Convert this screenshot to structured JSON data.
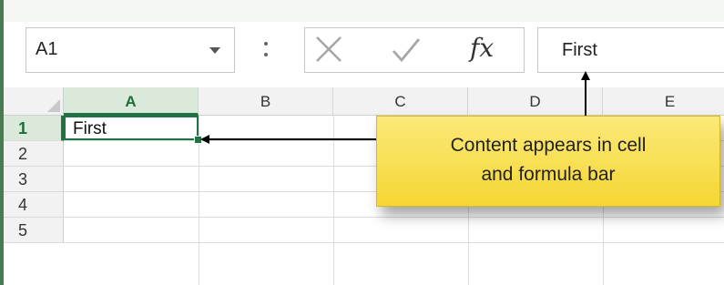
{
  "name_box": {
    "value": "A1"
  },
  "formula_bar": {
    "value": "First"
  },
  "columns": [
    "A",
    "B",
    "C",
    "D",
    "E"
  ],
  "rows": [
    "1",
    "2",
    "3",
    "4",
    "5"
  ],
  "cells": {
    "A1": "First"
  },
  "selection": {
    "active_cell": "A1",
    "active_column": "A",
    "active_row": "1"
  },
  "callout": {
    "line1": "Content appears in cell",
    "line2": "and formula bar"
  },
  "colors": {
    "accent_green": "#217346",
    "callout_yellow": "#f5d633"
  },
  "icons": [
    "chevron-down-icon",
    "more-options-icon",
    "cancel-icon",
    "enter-checkmark-icon",
    "fx-icon"
  ]
}
